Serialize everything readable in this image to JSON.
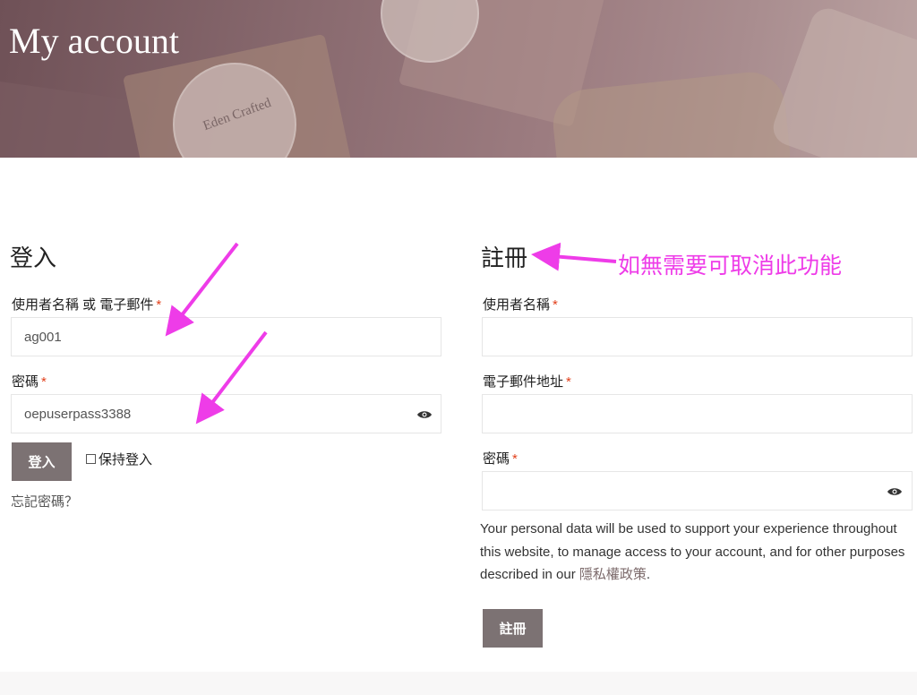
{
  "hero": {
    "title": "My account",
    "badge_text": "Eden Crafted"
  },
  "login": {
    "heading": "登入",
    "username_label": "使用者名稱 或 電子郵件",
    "username_value": "ag001",
    "password_label": "密碼",
    "password_value": "oepuserpass3388",
    "required_mark": "*",
    "submit_label": "登入",
    "remember_label": "保持登入",
    "lost_password": "忘記密碼？"
  },
  "register": {
    "heading": "註冊",
    "username_label": "使用者名稱",
    "email_label": "電子郵件地址",
    "password_label": "密碼",
    "required_mark": "*",
    "privacy_text": "Your personal data will be used to support your experience throughout this website, to manage access to your account, and for other purposes described in our ",
    "privacy_link": "隱私權政策",
    "privacy_end": ".",
    "submit_label": "註冊"
  },
  "annotation": {
    "note": "如無需要可取消此功能",
    "color": "#ee3ce8"
  },
  "icons": [
    "eye-icon"
  ],
  "colors": {
    "button": "#7c7273",
    "required": "#e2401c",
    "link": "#7c6a6b"
  }
}
